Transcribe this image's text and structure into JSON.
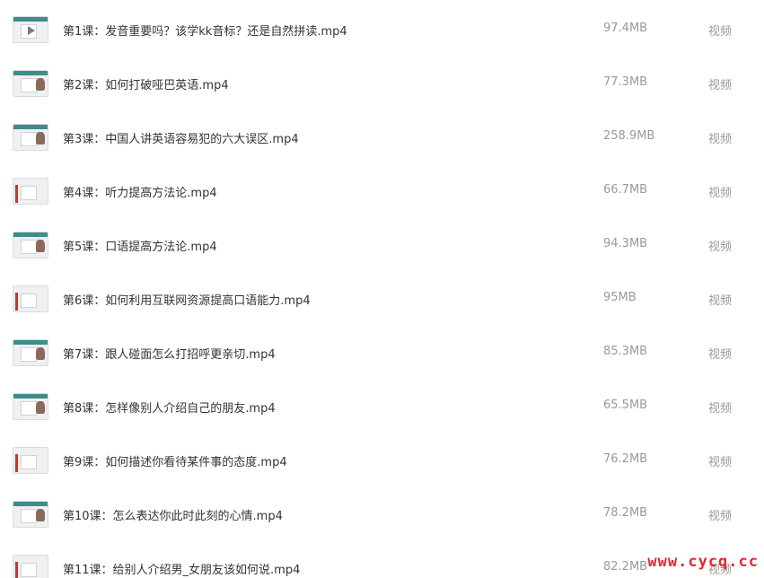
{
  "files": [
    {
      "name": "第1课：发音重要吗？该学kk音标？还是自然拼读.mp4",
      "size": "97.4MB",
      "type": "视频"
    },
    {
      "name": "第2课：如何打破哑巴英语.mp4",
      "size": "77.3MB",
      "type": "视频"
    },
    {
      "name": "第3课：中国人讲英语容易犯的六大误区.mp4",
      "size": "258.9MB",
      "type": "视频"
    },
    {
      "name": "第4课：听力提高方法论.mp4",
      "size": "66.7MB",
      "type": "视频"
    },
    {
      "name": "第5课：口语提高方法论.mp4",
      "size": "94.3MB",
      "type": "视频"
    },
    {
      "name": "第6课：如何利用互联网资源提高口语能力.mp4",
      "size": "95MB",
      "type": "视频"
    },
    {
      "name": "第7课：跟人碰面怎么打招呼更亲切.mp4",
      "size": "85.3MB",
      "type": "视频"
    },
    {
      "name": "第8课：怎样像别人介绍自己的朋友.mp4",
      "size": "65.5MB",
      "type": "视频"
    },
    {
      "name": "第9课：如何描述你看待某件事的态度.mp4",
      "size": "76.2MB",
      "type": "视频"
    },
    {
      "name": "第10课：怎么表达你此时此刻的心情.mp4",
      "size": "78.2MB",
      "type": "视频"
    },
    {
      "name": "第11课：给别人介绍男_女朋友该如何说.mp4",
      "size": "82.2MB",
      "type": "视频"
    }
  ],
  "watermark": "www.cycq.cc",
  "colors": {
    "name_text": "#333333",
    "meta_text": "#999999",
    "thumb_accent": "#3f8c8a",
    "watermark": "#e8262c"
  },
  "icons": {
    "thumbnail": "video-thumbnail-icon",
    "play": "play-icon"
  }
}
